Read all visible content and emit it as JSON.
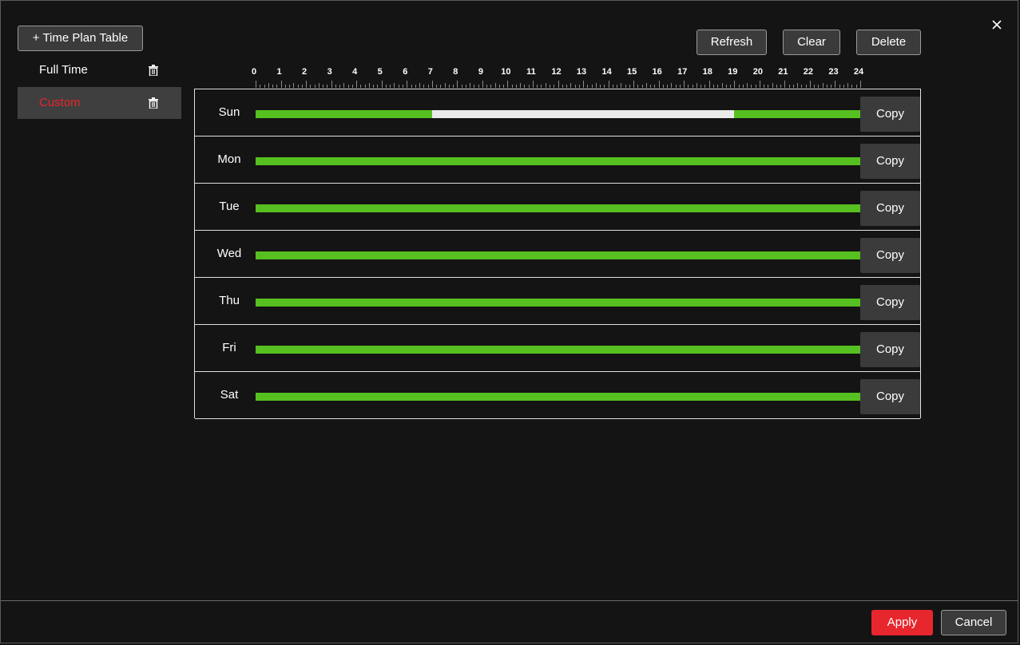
{
  "toolbar": {
    "add_plan_label": "+ Time Plan Table",
    "refresh_label": "Refresh",
    "clear_label": "Clear",
    "delete_label": "Delete"
  },
  "plans": [
    {
      "label": "Full Time",
      "selected": false
    },
    {
      "label": "Custom",
      "selected": true
    }
  ],
  "ruler": {
    "hours": [
      "0",
      "1",
      "2",
      "3",
      "4",
      "5",
      "6",
      "7",
      "8",
      "9",
      "10",
      "11",
      "12",
      "13",
      "14",
      "15",
      "16",
      "17",
      "18",
      "19",
      "20",
      "21",
      "22",
      "23",
      "24"
    ]
  },
  "schedule": {
    "copy_label": "Copy",
    "days": [
      {
        "label": "Sun",
        "segments": [
          [
            0,
            7
          ],
          [
            19,
            24
          ]
        ]
      },
      {
        "label": "Mon",
        "segments": [
          [
            0,
            24
          ]
        ]
      },
      {
        "label": "Tue",
        "segments": [
          [
            0,
            24
          ]
        ]
      },
      {
        "label": "Wed",
        "segments": [
          [
            0,
            24
          ]
        ]
      },
      {
        "label": "Thu",
        "segments": [
          [
            0,
            24
          ]
        ]
      },
      {
        "label": "Fri",
        "segments": [
          [
            0,
            24
          ]
        ]
      },
      {
        "label": "Sat",
        "segments": [
          [
            0,
            24
          ]
        ]
      }
    ]
  },
  "colors": {
    "active": "#55c020",
    "inactive": "#eaeaea",
    "accent": "#e8262d"
  },
  "icons": {
    "close": "close-icon",
    "trash": "trash-icon"
  },
  "footer": {
    "apply_label": "Apply",
    "cancel_label": "Cancel"
  }
}
